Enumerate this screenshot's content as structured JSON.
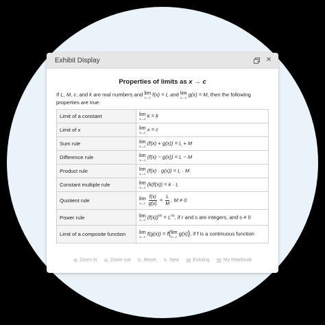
{
  "window": {
    "title": "Exhibit Display",
    "restore_icon": "restore-window-icon",
    "close_icon": "close-icon"
  },
  "heading": {
    "prefix": "Properties of limits as ",
    "var": "x",
    "arrow": " → ",
    "target": "c"
  },
  "intro": {
    "p1": "If ",
    "L": "L",
    "c1": ", ",
    "M": "M",
    "c2": ", ",
    "c": "c",
    "p2": ", and ",
    "k": "k",
    "p3": " are real numbers and ",
    "lim1_top": "lim",
    "lim1_bot": "x→c",
    "f1": "f(x) = L",
    "p4": " and ",
    "lim2_top": "lim",
    "lim2_bot": "x→c",
    "g1": "g(x) = M",
    "p5": ", then the following properties are true:"
  },
  "rows": [
    {
      "name": "Limit of a constant",
      "lim": "lim",
      "sub": "x→c",
      "expr": "k = k"
    },
    {
      "name": "Limit of x",
      "lim": "lim",
      "sub": "x→c",
      "expr": "x = c"
    },
    {
      "name": "Sum rule",
      "lim": "lim",
      "sub": "x→c",
      "expr": "(f(x) + g(x)) = L + M"
    },
    {
      "name": "Difference rule",
      "lim": "lim",
      "sub": "x→c",
      "expr": "(f(x) − g(x)) = L − M"
    },
    {
      "name": "Product rule",
      "lim": "lim",
      "sub": "x→c",
      "expr": "(f(x) · g(x)) = L · M"
    },
    {
      "name": "Constant multiple rule",
      "lim": "lim",
      "sub": "x→c",
      "expr": "(k(f(x)) = k · L"
    },
    {
      "name": "Quotient rule",
      "lim": "lim",
      "sub": "x→c",
      "num1": "f(x)",
      "den1": "g(x)",
      "eq": " = ",
      "num2": "L",
      "den2": "M",
      "tail": ", M ≠ 0"
    },
    {
      "name": "Power rule",
      "lim": "lim",
      "sub": "x→c",
      "base": "(f(x))",
      "exp1": "r/s",
      "eq": " = L",
      "exp2": "r/s",
      "tail": ", if r and s are integers, and s ≠ 0"
    },
    {
      "name": "Limit of a composite function",
      "lim": "lim",
      "sub": "x→c",
      "expr1": "f(g(x)) = f",
      "inner_lim": "lim",
      "inner_sub": "x→c",
      "inner": "g(x)",
      "tail": ", if f is a continuous function"
    }
  ],
  "toolbar": [
    {
      "icon": "zoom-in-icon",
      "label": "Zoom in"
    },
    {
      "icon": "zoom-out-icon",
      "label": "Zoom out"
    },
    {
      "icon": "reset-icon",
      "label": "Reset"
    },
    {
      "icon": "new-icon",
      "label": "New"
    },
    {
      "icon": "existing-icon",
      "label": "Existing"
    },
    {
      "icon": "notebook-icon",
      "label": "My Notebook"
    }
  ]
}
